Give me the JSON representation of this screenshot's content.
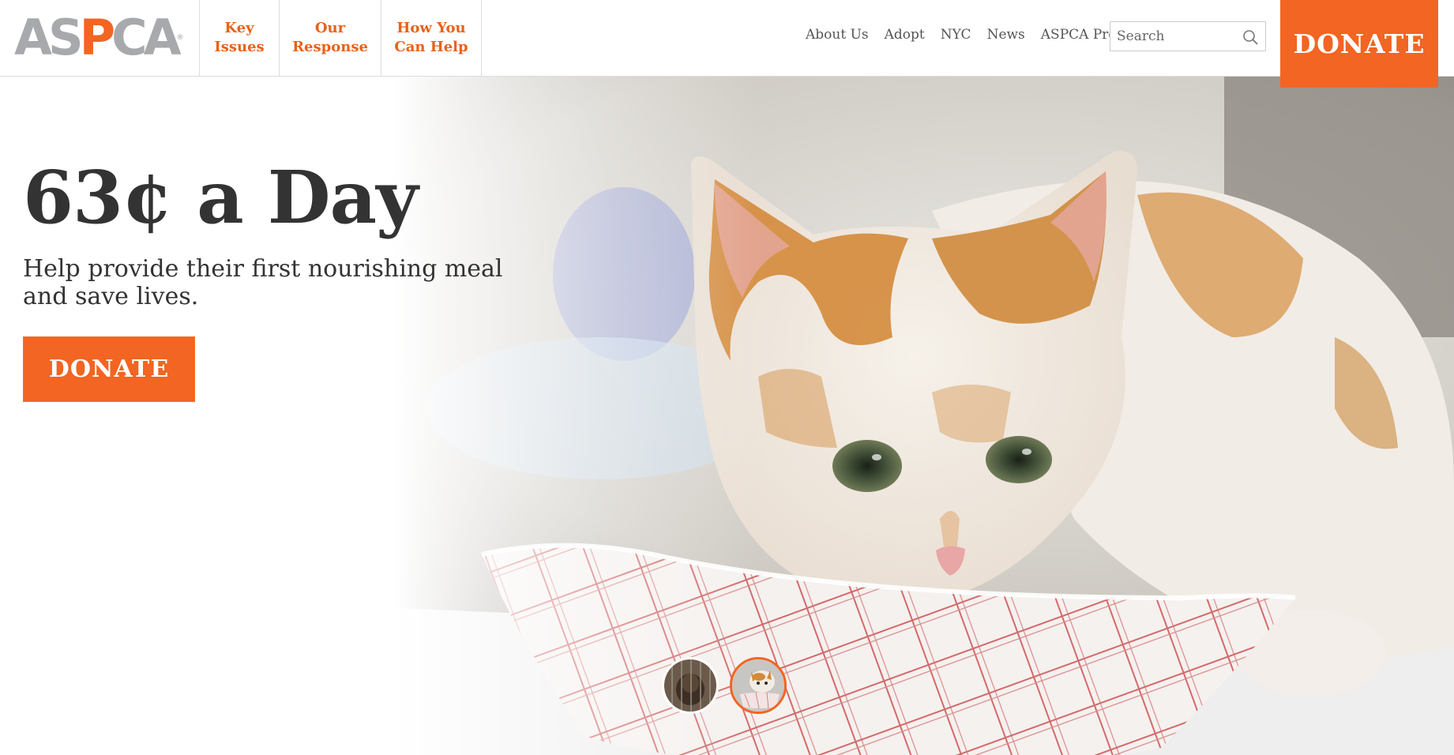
{
  "header": {
    "logo": {
      "part1": "AS",
      "part2": "P",
      "part3": "CA",
      "reg": "®"
    },
    "main_nav": [
      {
        "line1": "Key",
        "line2": "Issues"
      },
      {
        "line1": "Our",
        "line2": "Response"
      },
      {
        "line1": "How You",
        "line2": "Can Help"
      }
    ],
    "util_nav": [
      "About Us",
      "Adopt",
      "NYC",
      "News",
      "ASPCA Pro"
    ],
    "search": {
      "placeholder": "Search",
      "icon": "search-icon"
    },
    "donate_label": "DONATE"
  },
  "hero": {
    "title": "63¢ a Day",
    "subtitle": "Help provide their first nourishing meal and save lives.",
    "donate_label": "DONATE",
    "carousel": [
      {
        "label": "dog-slide",
        "active": false
      },
      {
        "label": "kitten-slide",
        "active": true
      }
    ]
  },
  "colors": {
    "accent": "#f26522",
    "logo_grey": "#a7a9ac",
    "text": "#333333",
    "nav_text": "#e8621a"
  }
}
